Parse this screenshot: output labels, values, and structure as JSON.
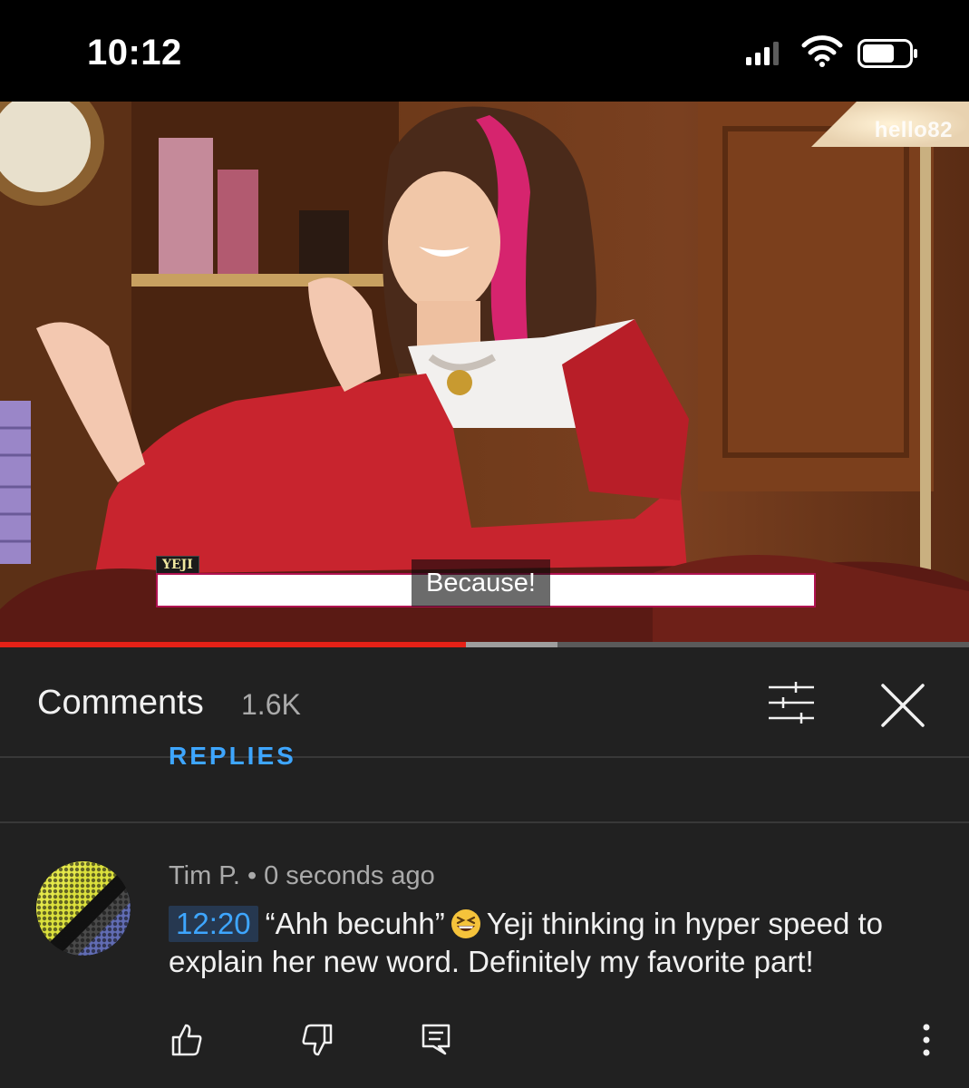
{
  "status_bar": {
    "time": "10:12"
  },
  "video": {
    "watermark": "hello82",
    "speaker_tag": "YEJI",
    "caption": "Because!",
    "progress_played": 0.481,
    "progress_buffered": 0.575
  },
  "comments_panel": {
    "title": "Comments",
    "count": "1.6K",
    "replies_peek": "REPLIES"
  },
  "comment": {
    "author": "Tim P.",
    "separator": "•",
    "time_ago": "0 seconds ago",
    "timestamp": "12:20",
    "text_before_emoji": "“Ahh becuhh”",
    "text_after_emoji": "Yeji thinking in hyper speed to explain her new word. Definitely my favorite part!",
    "emoji": "grinning-squinting-face"
  },
  "icons": {
    "filter": "sliders-icon",
    "close": "close-icon",
    "like": "thumbs-up-icon",
    "dislike": "thumbs-down-icon",
    "reply": "reply-icon",
    "more": "more-vert-icon"
  },
  "colors": {
    "background": "#212121",
    "accent_link": "#3ea6ff",
    "progress_red": "#e62117"
  }
}
